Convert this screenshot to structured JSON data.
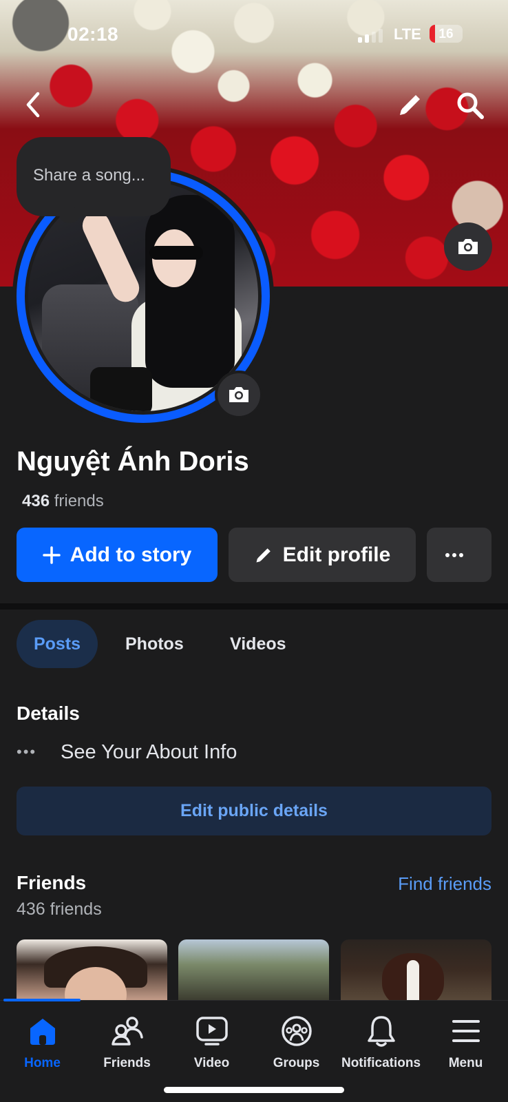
{
  "status_bar": {
    "time": "02:18",
    "network": "LTE",
    "battery": "16",
    "battery_level_percent": 16
  },
  "header": {
    "back_icon": "chevron-left-icon",
    "edit_icon": "pencil-icon",
    "search_icon": "search-icon",
    "cover_camera_icon": "camera-icon"
  },
  "profile": {
    "song_prompt": "Share a song...",
    "name": "Nguyệt Ánh Doris",
    "friends_count": "436",
    "friends_word": "friends",
    "avatar_camera_icon": "camera-icon"
  },
  "actions": {
    "add_to_story": "Add to story",
    "edit_profile": "Edit profile",
    "more": "···"
  },
  "tabs": [
    {
      "label": "Posts",
      "active": true
    },
    {
      "label": "Photos",
      "active": false
    },
    {
      "label": "Videos",
      "active": false
    }
  ],
  "details": {
    "title": "Details",
    "about_link": "See Your About Info",
    "edit_button": "Edit public details"
  },
  "friends": {
    "title": "Friends",
    "find_friends": "Find friends",
    "count_text": "436 friends"
  },
  "bottom_nav": [
    {
      "label": "Home",
      "icon": "home-icon",
      "active": true
    },
    {
      "label": "Friends",
      "icon": "friends-icon",
      "active": false
    },
    {
      "label": "Video",
      "icon": "video-icon",
      "active": false
    },
    {
      "label": "Groups",
      "icon": "groups-icon",
      "active": false
    },
    {
      "label": "Notifications",
      "icon": "bell-icon",
      "active": false
    },
    {
      "label": "Menu",
      "icon": "menu-icon",
      "active": false
    }
  ],
  "colors": {
    "background": "#1c1c1d",
    "accent": "#0866ff",
    "link": "#5a9cf7",
    "button_secondary": "#323234"
  }
}
